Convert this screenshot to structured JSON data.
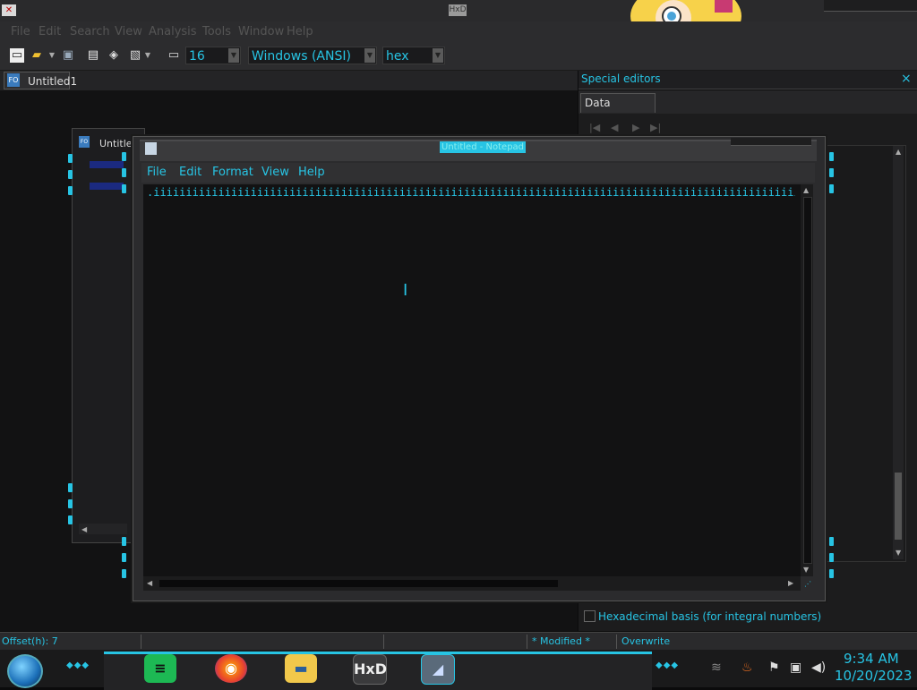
{
  "hxd": {
    "app_icon": "hxd-app-icon",
    "title": "HxD",
    "menu": [
      "File",
      "Edit",
      "Search",
      "View",
      "Analysis",
      "Tools",
      "Window",
      "Help"
    ],
    "toolbar": {
      "bytes_per_row": "16",
      "charset": "Windows (ANSI)",
      "offset_base": "hex"
    },
    "doc_tab": "Untitled1",
    "special_editors": {
      "title": "Special editors",
      "close": "×",
      "tab": "Data inspector",
      "hex_basis_label": "Hexadecimal basis (for integral numbers)"
    },
    "status": {
      "offset": "Offset(h): 7",
      "modified": "* Modified *",
      "mode": "Overwrite"
    }
  },
  "back_window": {
    "title": "Untitle"
  },
  "notepad": {
    "title": "Untitled - Notepad",
    "menu": [
      "File",
      "Edit",
      "Format",
      "View",
      "Help"
    ],
    "content": ".iiiiiiiiiiiiiiiiiiiiiiiiiiiiiiiiiiiiiiiiiiiiiiiiiiiiiiiiiiiiiiiiiiiiiiiiiiiiiiiiiiiiiiiiiiiiiiiiiiiiiiiiiiiiiiiiiiii"
  },
  "taskbar": {
    "time": "9:34 AM",
    "date": "10/20/2023"
  },
  "colors": {
    "accent": "#27c4e4",
    "background": "#121213"
  }
}
